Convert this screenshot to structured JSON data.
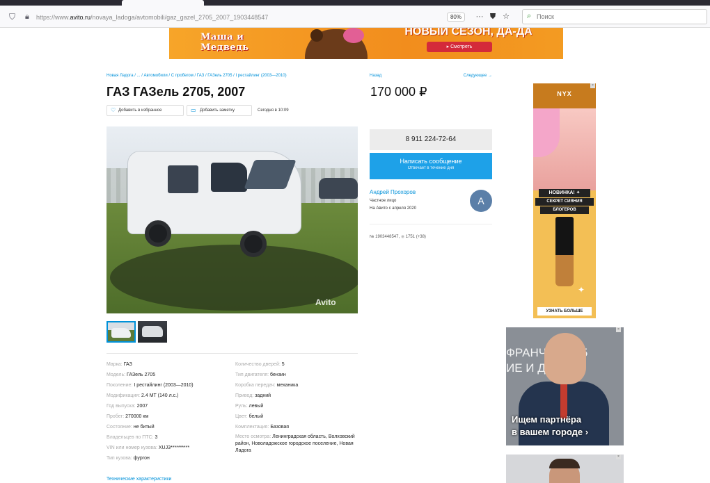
{
  "browser": {
    "url_prefix": "https://www.",
    "url_domain": "avito.ru",
    "url_path": "/novaya_ladoga/avtomobili/gaz_gazel_2705_2007_1903448547",
    "zoom": "80%",
    "search_placeholder": "Поиск"
  },
  "top_banner": {
    "logo": "Маша и Медведь",
    "slogan": "НОВЫЙ СЕЗОН, ДА-ДА",
    "button": "▸ Смотреть"
  },
  "breadcrumb": "Новая Ладога / ... / Автомобили / С пробегом / ГАЗ / ГАЗель 2705 / I рестайлинг (2003—2010)",
  "nav": {
    "back": "Назад",
    "next": "Следующее →"
  },
  "listing": {
    "title": "ГАЗ ГАЗель 2705, 2007",
    "price": "170 000 ₽",
    "fav_label": "Добавить в избранное",
    "note_label": "Добавить заметку",
    "posted": "Сегодня в 10:09",
    "watermark": "Avito"
  },
  "params_left": [
    {
      "key": "Марка:",
      "value": "ГАЗ"
    },
    {
      "key": "Модель:",
      "value": "ГАЗель 2705"
    },
    {
      "key": "Поколение:",
      "value": "I рестайлинг (2003—2010)"
    },
    {
      "key": "Модификация:",
      "value": "2.4 MT (140 л.с.)"
    },
    {
      "key": "Год выпуска:",
      "value": "2007"
    },
    {
      "key": "Пробег:",
      "value": "270000 км"
    },
    {
      "key": "Состояние:",
      "value": "не битый"
    },
    {
      "key": "Владельцев по ПТС:",
      "value": "3"
    },
    {
      "key": "VIN или номер кузова:",
      "value": "XUJ3**********"
    },
    {
      "key": "Тип кузова:",
      "value": "фургон"
    }
  ],
  "params_right": [
    {
      "key": "Количество дверей:",
      "value": "5"
    },
    {
      "key": "Тип двигателя:",
      "value": "бензин"
    },
    {
      "key": "Коробка передач:",
      "value": "механика"
    },
    {
      "key": "Привод:",
      "value": "задний"
    },
    {
      "key": "Руль:",
      "value": "левый"
    },
    {
      "key": "Цвет:",
      "value": "белый"
    },
    {
      "key": "Комплектация:",
      "value": "Базовая"
    },
    {
      "key": "Место осмотра:",
      "value": "Ленинградская область, Волховский район, Новоладожское городское поселение, Новая Ладога"
    }
  ],
  "tech_link": "Технические характеристики",
  "contact": {
    "phone": "8 911 224-72-64",
    "message_title": "Написать сообщение",
    "message_sub": "Отвечает в течение дня",
    "seller_name": "Андрей Прохоров",
    "seller_type": "Частное лицо",
    "seller_since": "На Авито с апреля 2020",
    "avatar_letter": "A",
    "ad_number": "№ 1903448547,",
    "views": "1751 (+38)"
  },
  "ads": {
    "nyx_brand": "NYX",
    "nyx_badge1": "НОВИНКА! ✦",
    "nyx_badge2": "СЕКРЕТ СИЯНИЯ",
    "nyx_badge3": "БЛОГЕРОВ",
    "nyx_cta": "УЗНАТЬ БОЛЬШЕ",
    "franch_bg": "ФРАНЧ ВИНГ5\nИЕ И ДАЖА",
    "franch_headline": "Ищем партнёра\nв вашем городе ›",
    "close": "×"
  }
}
